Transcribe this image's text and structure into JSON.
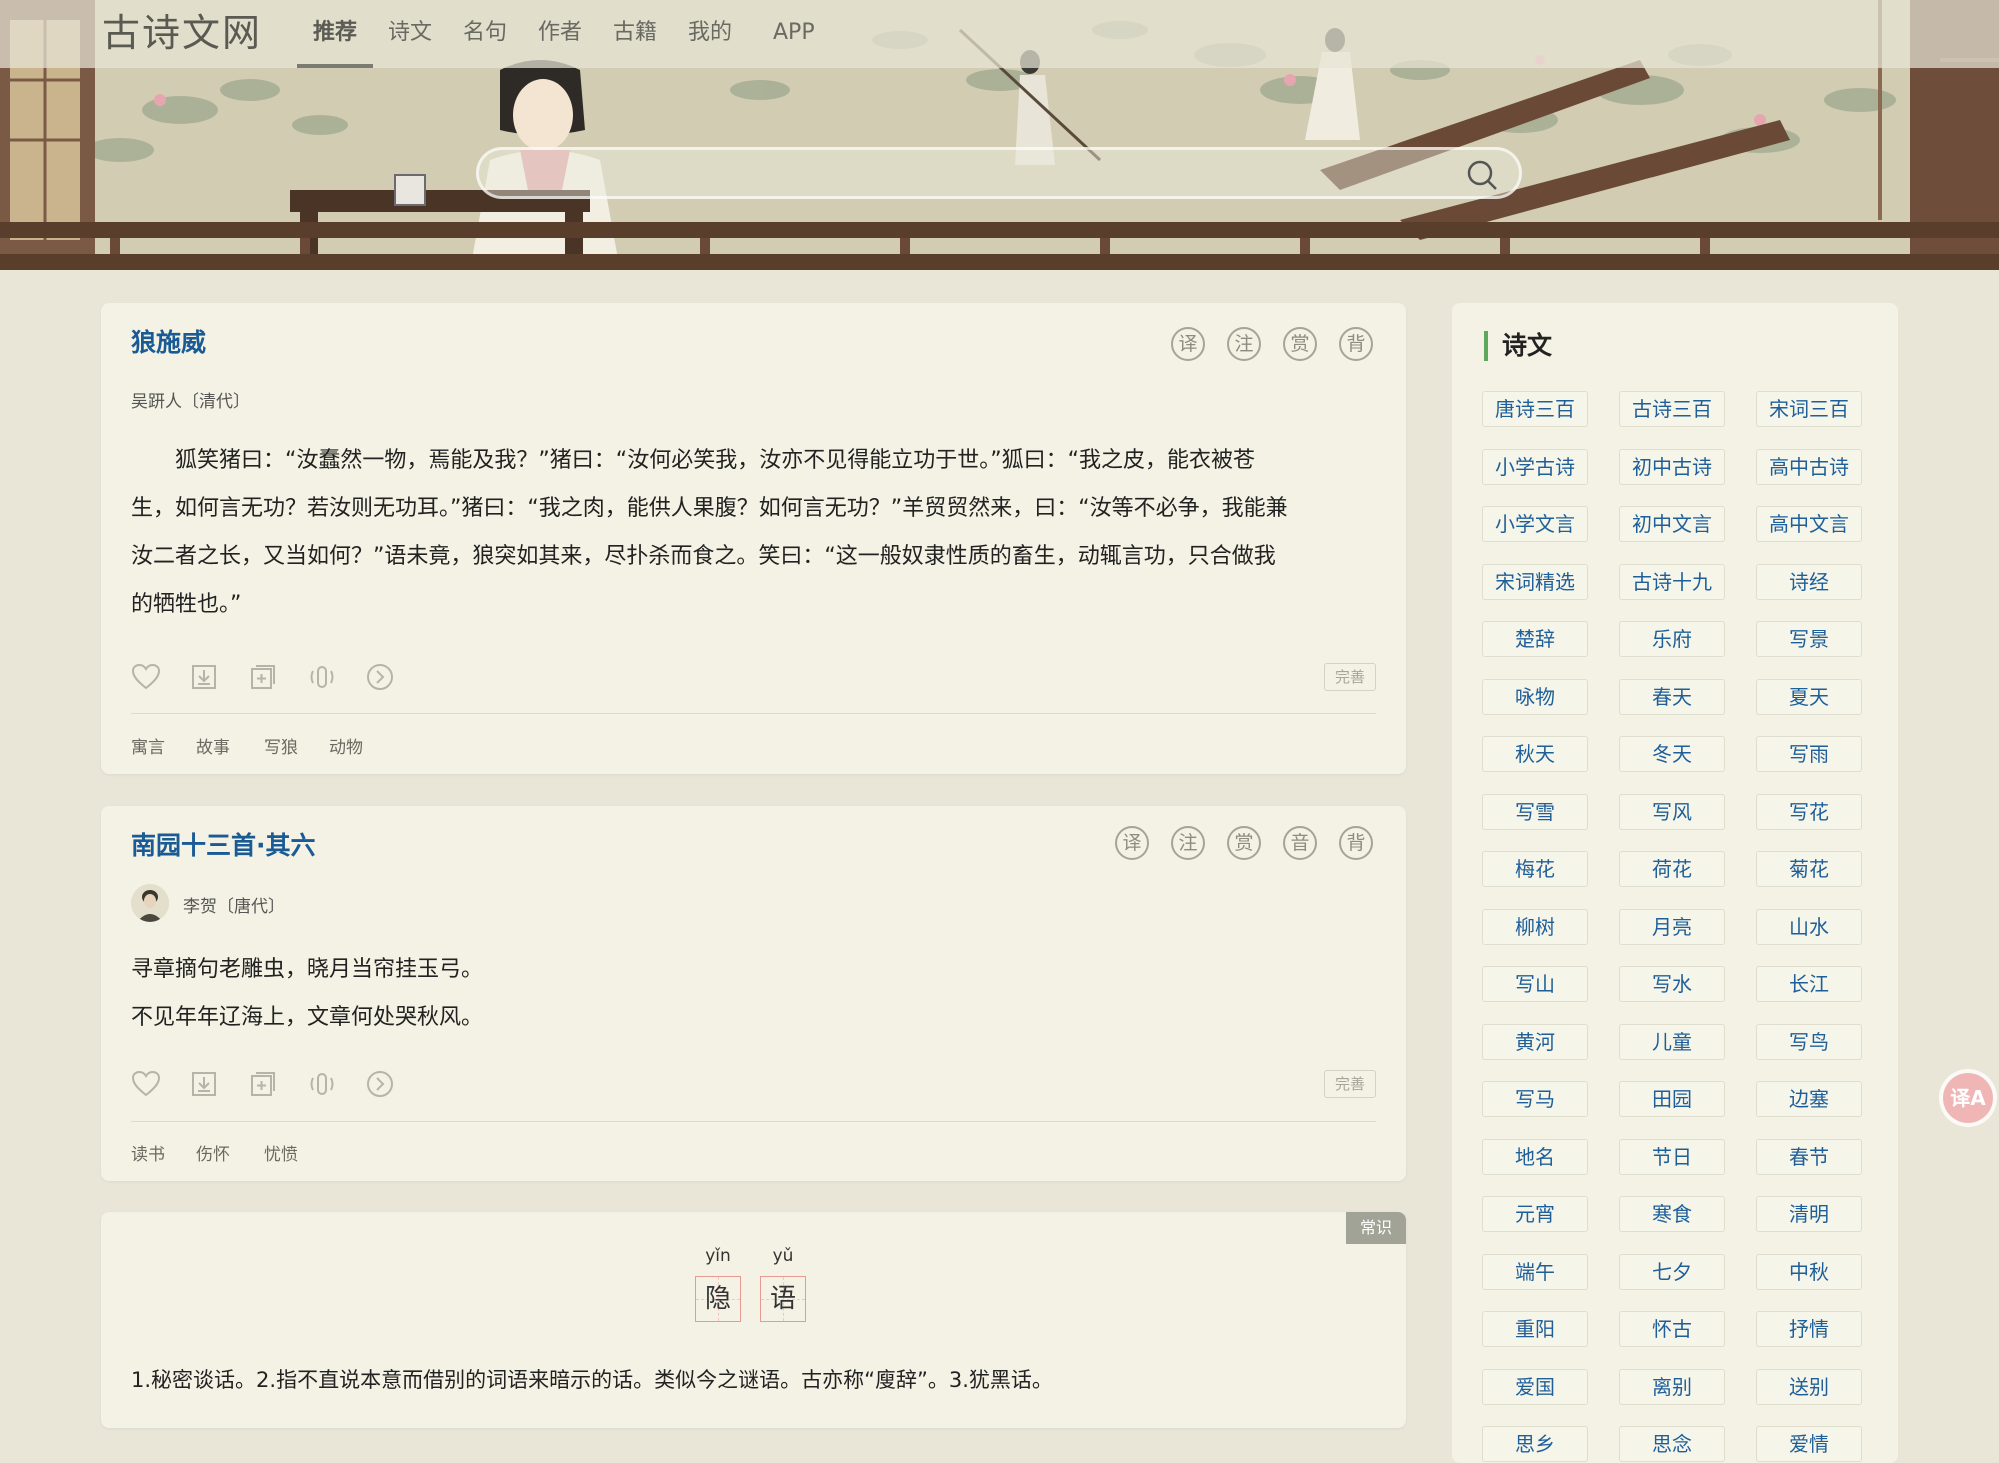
{
  "header": {
    "logo": "古诗文网",
    "nav": [
      "推荐",
      "诗文",
      "名句",
      "作者",
      "古籍",
      "我的",
      "APP"
    ],
    "active_nav": "推荐",
    "search": {
      "placeholder": "",
      "icon": "search-icon"
    }
  },
  "poem1": {
    "title": "狼施威",
    "author": "吴趼人〔清代〕",
    "buttons": [
      "译",
      "注",
      "赏",
      "背"
    ],
    "lines": [
      "　　狐笑猪曰：“汝蠢然一物，焉能及我？”猪曰：“汝何必笑我，汝亦不见得能立功于世。”狐曰：“我之皮，能衣被苍",
      "生，如何言无功？若汝则无功耳。”猪曰：“我之肉，能供人果腹？如何言无功？”羊贸贸然来，曰：“汝等不必争，我能兼",
      "汝二者之长，又当如何？”语未竟，狼突如其来，尽扑杀而食之。笑曰：“这一般奴隶性质的畜生，动辄言功，只合做我",
      "的牺牲也。”"
    ],
    "fix_label": "完善",
    "tags": [
      "寓言",
      "故事",
      "写狼",
      "动物"
    ]
  },
  "poem2": {
    "title": "南园十三首·其六",
    "author": "李贺〔唐代〕",
    "buttons": [
      "译",
      "注",
      "赏",
      "音",
      "背"
    ],
    "lines": [
      "寻章摘句老雕虫，晓月当帘挂玉弓。",
      "不见年年辽海上，文章何处哭秋风。"
    ],
    "fix_label": "完善",
    "tags": [
      "读书",
      "伤怀",
      "忧愤"
    ]
  },
  "knowledge": {
    "badge": "常识",
    "words": [
      {
        "pinyin": "yǐn",
        "char": "隐"
      },
      {
        "pinyin": "yǔ",
        "char": "语"
      }
    ],
    "definition": "1.秘密谈话。2.指不直说本意而借别的词语来暗示的话。类似今之谜语。古亦称“廋辞”。3.犹黑话。"
  },
  "sidebar": {
    "title": "诗文",
    "items": [
      "唐诗三百",
      "古诗三百",
      "宋词三百",
      "小学古诗",
      "初中古诗",
      "高中古诗",
      "小学文言",
      "初中文言",
      "高中文言",
      "宋词精选",
      "古诗十九",
      "诗经",
      "楚辞",
      "乐府",
      "写景",
      "咏物",
      "春天",
      "夏天",
      "秋天",
      "冬天",
      "写雨",
      "写雪",
      "写风",
      "写花",
      "梅花",
      "荷花",
      "菊花",
      "柳树",
      "月亮",
      "山水",
      "写山",
      "写水",
      "长江",
      "黄河",
      "儿童",
      "写鸟",
      "写马",
      "田园",
      "边塞",
      "地名",
      "节日",
      "春节",
      "元宵",
      "寒食",
      "清明",
      "端午",
      "七夕",
      "中秋",
      "重阳",
      "怀古",
      "抒情",
      "爱国",
      "离别",
      "送别",
      "思乡",
      "思念",
      "爱情"
    ]
  },
  "float_button": {
    "label": "译A",
    "icon": "translate-icon"
  },
  "colors": {
    "link": "#1a5a95",
    "accent": "#5ea85e",
    "background": "#e9e6d8",
    "card": "#f3f2e4"
  }
}
